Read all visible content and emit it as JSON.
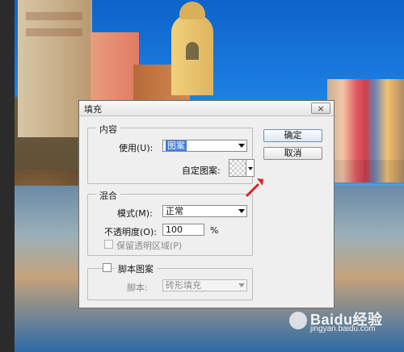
{
  "dialog": {
    "title": "填充",
    "close_label": "×",
    "buttons": {
      "ok": "确定",
      "cancel": "取消"
    },
    "content_group": {
      "legend": "内容",
      "use_label": "使用(U):",
      "use_value": "图案",
      "custom_pattern_label": "自定图案:"
    },
    "blend_group": {
      "legend": "混合",
      "mode_label": "模式(M):",
      "mode_value": "正常",
      "opacity_label": "不透明度(O):",
      "opacity_value": "100",
      "percent": "%",
      "preserve_transparency_label": "保留透明区域(P)"
    },
    "script_group": {
      "checkbox_label": "脚本图案",
      "script_label": "脚本:",
      "script_value": "砖形填充"
    }
  },
  "watermark": {
    "text": "Baidu经验",
    "sub": "jingyan.baidu.com"
  },
  "colors": {
    "selection_blue": "#3b78d8",
    "arrow_red": "#e02020"
  },
  "icons": {
    "close": "close-icon",
    "dropdown": "chevron-down-icon",
    "pointer": "red-arrow-icon",
    "paw": "paw-logo-icon"
  }
}
